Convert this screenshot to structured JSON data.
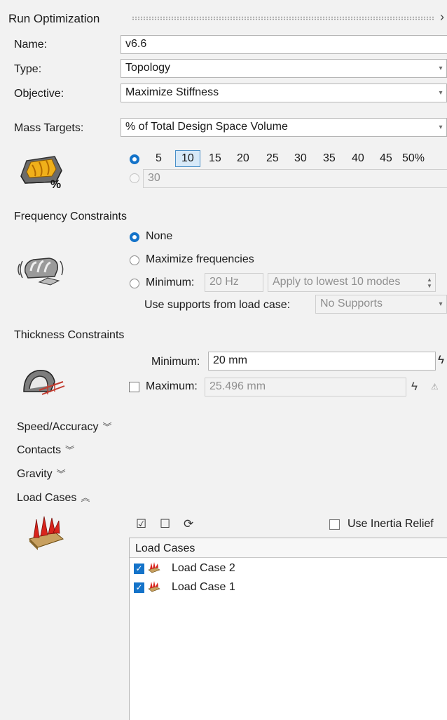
{
  "header": {
    "title": "Run Optimization",
    "close_glyph": "›"
  },
  "form": {
    "name_label": "Name:",
    "name_value": "v6.6",
    "type_label": "Type:",
    "type_value": "Topology",
    "objective_label": "Objective:",
    "objective_value": "Maximize Stiffness",
    "mass_label": "Mass Targets:",
    "mass_value": "% of Total Design Space Volume"
  },
  "mass_targets": {
    "percent_options": [
      "5",
      "10",
      "15",
      "20",
      "25",
      "30",
      "35",
      "40",
      "45",
      "50%"
    ],
    "selected_percent": "10",
    "custom_value": "30",
    "icon_label": "%"
  },
  "frequency": {
    "title": "Frequency Constraints",
    "none_label": "None",
    "maximize_label": "Maximize frequencies",
    "minimum_label": "Minimum:",
    "minimum_value": "20 Hz",
    "modes_value": "Apply to lowest 10 modes",
    "supports_label": "Use supports from load case:",
    "supports_value": "No Supports"
  },
  "thickness": {
    "title": "Thickness Constraints",
    "minimum_label": "Minimum:",
    "minimum_value": "20 mm",
    "maximum_label": "Maximum:",
    "maximum_value": "25.496 mm"
  },
  "collapsibles": {
    "speed": "Speed/Accuracy",
    "contacts": "Contacts",
    "gravity": "Gravity",
    "load_cases": "Load Cases"
  },
  "load_cases": {
    "use_inertia_relief": "Use Inertia Relief",
    "column_header": "Load Cases",
    "items": [
      "Load Case 2",
      "Load Case 1"
    ]
  }
}
